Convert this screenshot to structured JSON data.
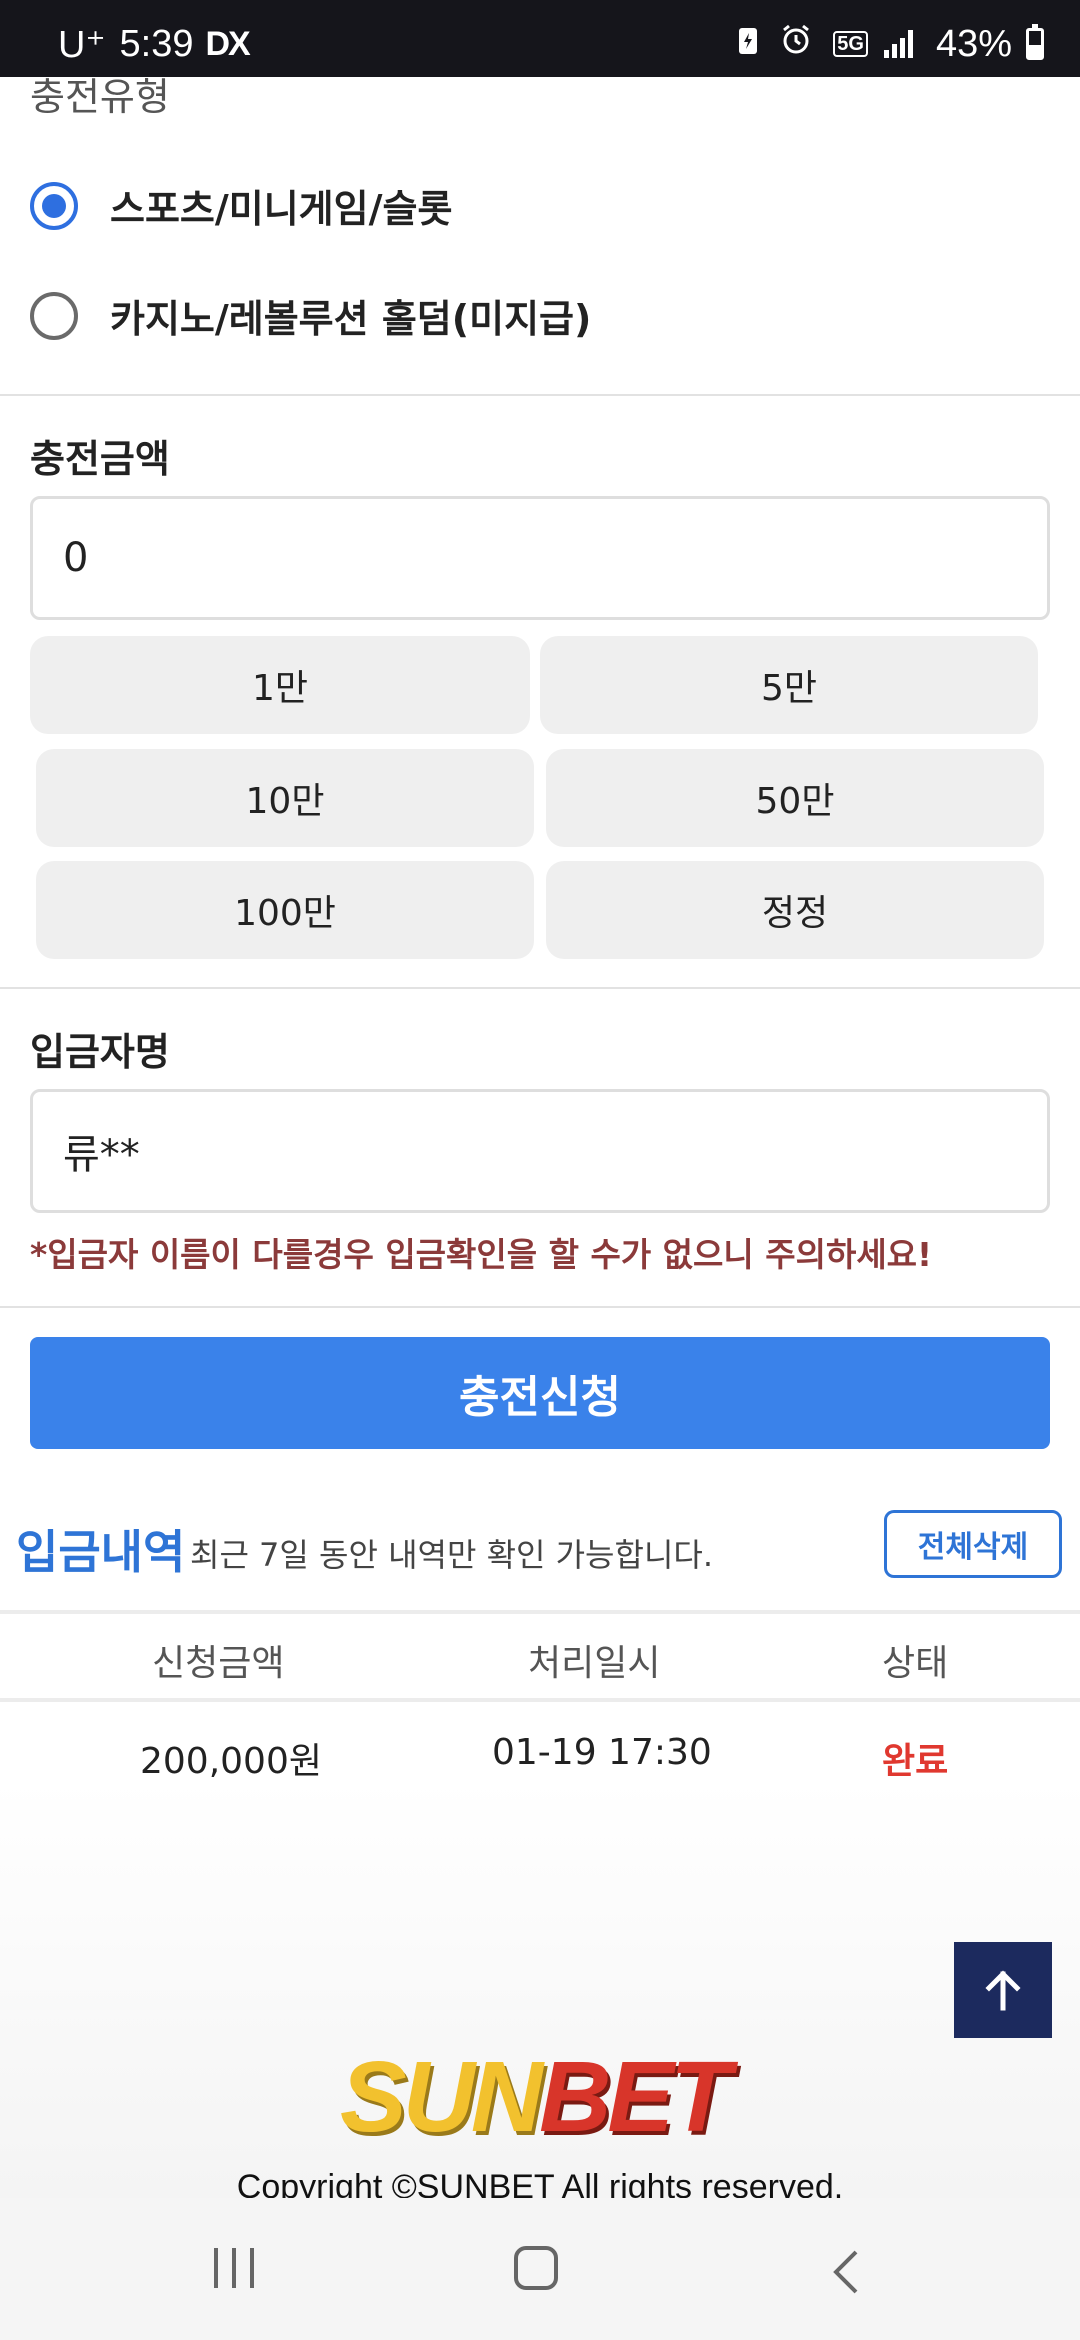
{
  "status_bar": {
    "carrier": "U⁺",
    "time": "5:39",
    "dx_label": "DX",
    "network": "5G",
    "battery": "43%"
  },
  "charge_type": {
    "label": "충전유형",
    "options": [
      {
        "label": "스포츠/미니게임/슬롯",
        "selected": true
      },
      {
        "label": "카지노/레볼루션 홀덤(미지급)",
        "selected": false
      }
    ]
  },
  "charge_amount": {
    "label": "충전금액",
    "value": "0",
    "buttons": [
      "1만",
      "5만",
      "10만",
      "50만",
      "100만",
      "정정"
    ]
  },
  "depositor": {
    "label": "입금자명",
    "value": "류**",
    "warning": "*입금자 이름이 다를경우 입금확인을 할 수가 없으니 주의하세요!"
  },
  "submit_label": "충전신청",
  "history": {
    "title": "입금내역",
    "note": "최근 7일 동안 내역만 확인 가능합니다.",
    "delete_all_label": "전체삭제",
    "columns": [
      "신청금액",
      "처리일시",
      "상태"
    ],
    "rows": [
      {
        "amount": "200,000원",
        "datetime": "01-19 17:30",
        "status": "완료"
      }
    ]
  },
  "footer": {
    "logo_part1": "SUN",
    "logo_part2": "BET",
    "copyright": "Copyright ©SUNBET All rights reserved."
  },
  "colors": {
    "accent_blue": "#3a82ea",
    "status_complete": "#e0382f",
    "scroll_top_bg": "#1c2a5e"
  }
}
